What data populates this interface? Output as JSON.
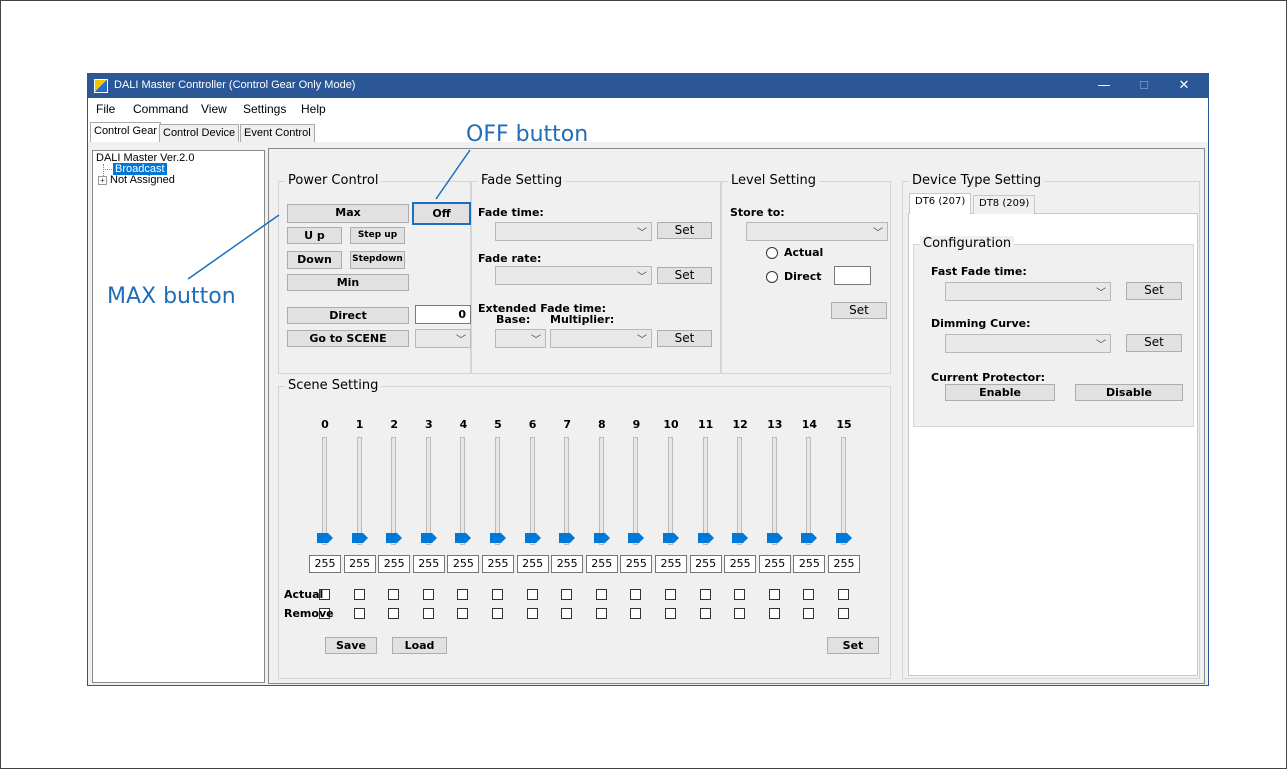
{
  "window": {
    "title": "DALI Master Controller (Control Gear Only Mode)",
    "minimize": "—",
    "maximize": "☐",
    "close": "✕"
  },
  "menu": [
    "File",
    "Command",
    "View",
    "Settings",
    "Help"
  ],
  "main_tabs": [
    "Control Gear",
    "Control Device",
    "Event Control"
  ],
  "tree": {
    "root": "DALI Master Ver.2.0",
    "selected": "Broadcast",
    "node": "Not Assigned",
    "expander": "+"
  },
  "power_control": {
    "title": "Power Control",
    "max": "Max",
    "off": "Off",
    "up": "U p",
    "step_up": "Step up",
    "down": "Down",
    "step_down": "Stepdown",
    "min": "Min",
    "direct": "Direct",
    "direct_value": "0",
    "go_to_scene": "Go to SCENE"
  },
  "fade_setting": {
    "title": "Fade Setting",
    "fade_time": "Fade time:",
    "fade_rate": "Fade rate:",
    "extended": "Extended Fade time:",
    "base": "Base:",
    "multiplier": "Multiplier:",
    "set": "Set"
  },
  "level_setting": {
    "title": "Level Setting",
    "store_to": "Store to:",
    "actual": "Actual",
    "direct": "Direct",
    "set": "Set"
  },
  "device_type": {
    "title": "Device Type Setting",
    "tabs": [
      "DT6 (207)",
      "DT8 (209)"
    ],
    "configuration": "Configuration",
    "fast_fade": "Fast Fade time:",
    "dimming_curve": "Dimming Curve:",
    "current_protector": "Current Protector:",
    "enable": "Enable",
    "disable": "Disable",
    "set": "Set"
  },
  "scene_setting": {
    "title": "Scene Setting",
    "scenes": [
      "0",
      "1",
      "2",
      "3",
      "4",
      "5",
      "6",
      "7",
      "8",
      "9",
      "10",
      "11",
      "12",
      "13",
      "14",
      "15"
    ],
    "values": [
      "255",
      "255",
      "255",
      "255",
      "255",
      "255",
      "255",
      "255",
      "255",
      "255",
      "255",
      "255",
      "255",
      "255",
      "255",
      "255"
    ],
    "actual": "Actual",
    "remove": "Remove",
    "save": "Save",
    "load": "Load",
    "set": "Set"
  },
  "annotations": {
    "off": "OFF button",
    "max": "MAX button"
  },
  "colors": {
    "titlebar": "#2b5797",
    "accent": "#1a6fc0",
    "selection": "#0078d7"
  }
}
